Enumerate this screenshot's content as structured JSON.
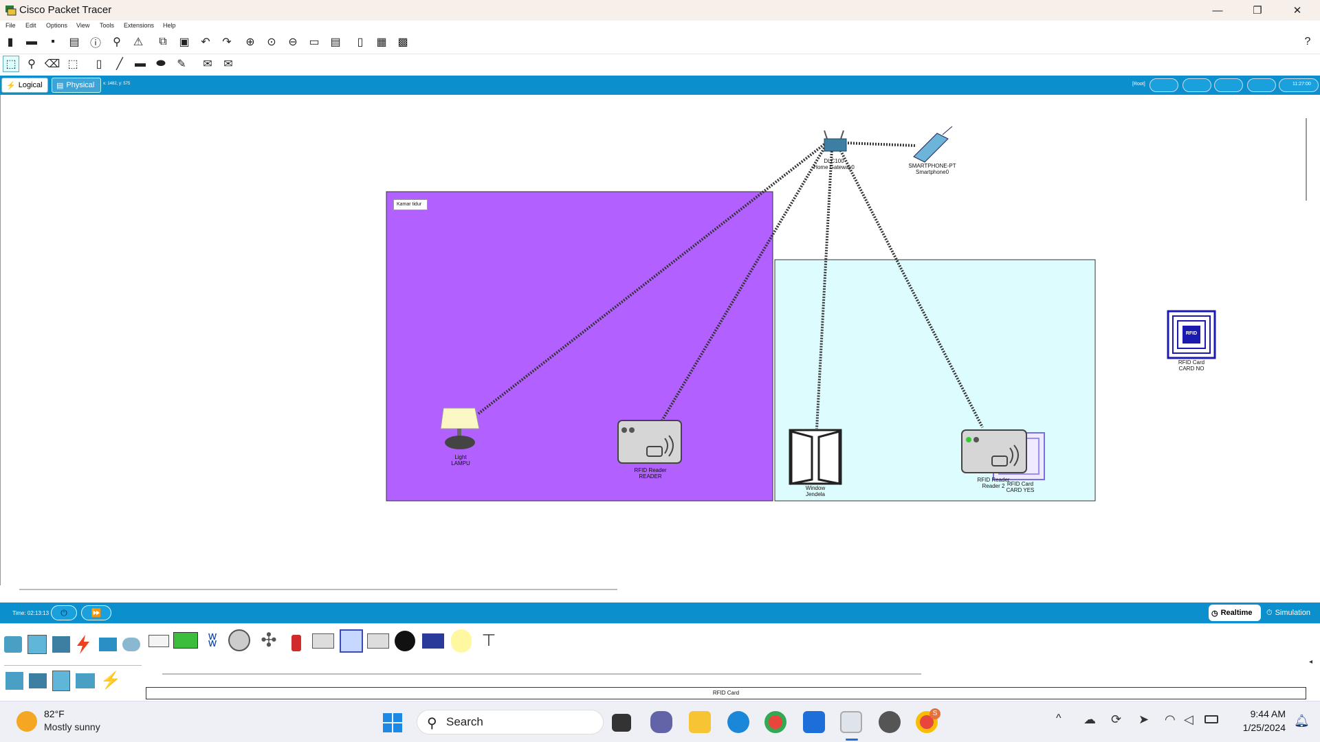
{
  "window": {
    "title": "Cisco Packet Tracer",
    "minimize": "—",
    "restore": "❐",
    "close": "✕"
  },
  "menu": [
    "File",
    "Edit",
    "Options",
    "View",
    "Tools",
    "Extensions",
    "Help"
  ],
  "help_icon": "?",
  "view_tabs": {
    "logical": "Logical",
    "physical": "Physical",
    "coords": "x: 1482, y: 575"
  },
  "topright": {
    "root": "[Root]",
    "clock": "11:27:00"
  },
  "workspace": {
    "room1_label": "Kamar tidur",
    "devices": {
      "gateway": {
        "line1": "DLC100",
        "line2": "Home Gateway0"
      },
      "smartphone": {
        "line1": "SMARTPHONE-PT",
        "line2": "Smartphone0"
      },
      "light": {
        "line1": "Light",
        "line2": "LAMPU"
      },
      "rfid_reader": {
        "line1": "RFID Reader",
        "line2": "READER"
      },
      "window": {
        "line1": "Window",
        "line2": "Jendela"
      },
      "rfid_reader2": {
        "line1": "RFID Reader",
        "line2": "Reader 2"
      },
      "rfid_card_yes": {
        "line1": "RFID Card",
        "line2": "CARD YES"
      },
      "rfid_card_no": {
        "line1": "RFID Card",
        "line2": "CARD NO",
        "logo": "RFID"
      }
    }
  },
  "timebar": {
    "time": "Time: 02:13:13",
    "realtime": "Realtime",
    "simulation": "Simulation"
  },
  "device_pane": {
    "selected_label": "RFID Card"
  },
  "taskbar": {
    "weather_temp": "82°F",
    "weather_desc": "Mostly sunny",
    "search_placeholder": "Search",
    "time": "9:44 AM",
    "date": "1/25/2024",
    "chrome_badge": "S"
  },
  "colors": {
    "room1": "#b260ff",
    "room2": "#ddfcfd",
    "accent": "#0c8fcd"
  }
}
